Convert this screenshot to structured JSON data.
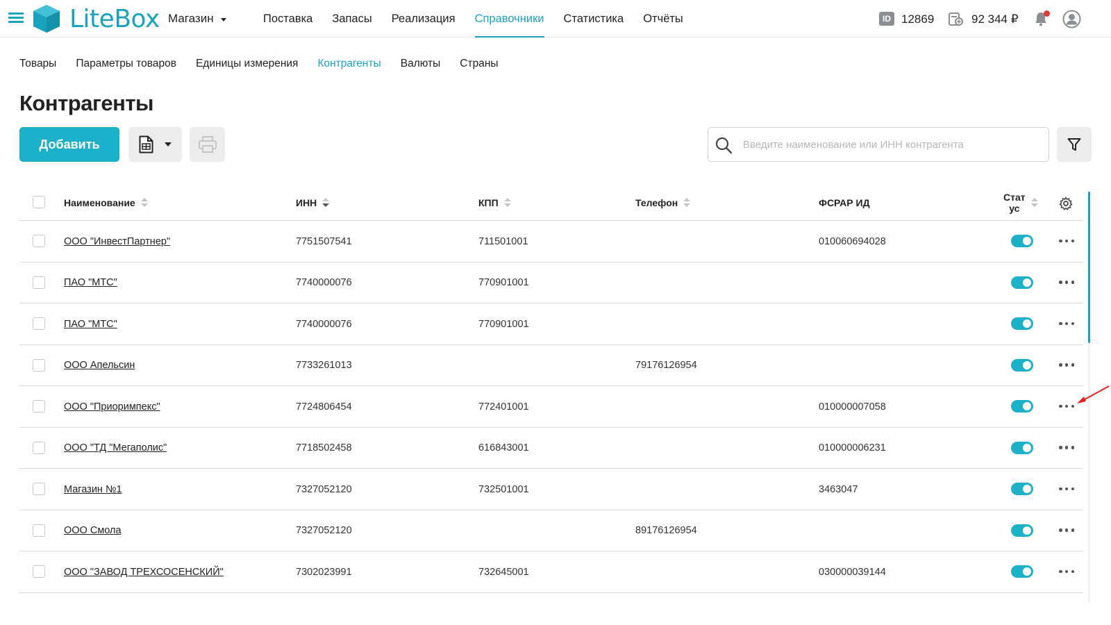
{
  "header": {
    "logo_text": "LiteBox",
    "store": "Магазин",
    "nav": [
      {
        "label": "Поставка"
      },
      {
        "label": "Запасы"
      },
      {
        "label": "Реализация"
      },
      {
        "label": "Справочники"
      },
      {
        "label": "Статистика"
      },
      {
        "label": "Отчёты"
      }
    ],
    "active_nav": "Справочники",
    "id_badge": "ID",
    "account_id": "12869",
    "balance": "92 344 ₽"
  },
  "subnav": {
    "items": [
      {
        "label": "Товары"
      },
      {
        "label": "Параметры товаров"
      },
      {
        "label": "Единицы измерения"
      },
      {
        "label": "Контрагенты"
      },
      {
        "label": "Валюты"
      },
      {
        "label": "Страны"
      }
    ],
    "active": "Контрагенты"
  },
  "page": {
    "title": "Контрагенты",
    "add_label": "Добавить",
    "search_placeholder": "Введите наименование или ИНН контрагента"
  },
  "table": {
    "columns": {
      "name": "Наименование",
      "inn": "ИНН",
      "kpp": "КПП",
      "phone": "Телефон",
      "fsrar": "ФСРАР ИД",
      "status_line1": "Стат",
      "status_line2": "ус"
    },
    "rows": [
      {
        "name": "ООО \"ИнвестПартнер\"",
        "inn": "7751507541",
        "kpp": "711501001",
        "phone": "",
        "fsrar": "010060694028",
        "status": true
      },
      {
        "name": "ПАО \"МТС\"",
        "inn": "7740000076",
        "kpp": "770901001",
        "phone": "",
        "fsrar": "",
        "status": true
      },
      {
        "name": "ПАО \"МТС\"",
        "inn": "7740000076",
        "kpp": "770901001",
        "phone": "",
        "fsrar": "",
        "status": true
      },
      {
        "name": "ООО Апельсин",
        "inn": "7733261013",
        "kpp": "",
        "phone": "79176126954",
        "fsrar": "",
        "status": true
      },
      {
        "name": "ООО \"Приоримпекс\"",
        "inn": "7724806454",
        "kpp": "772401001",
        "phone": "",
        "fsrar": "010000007058",
        "status": true
      },
      {
        "name": "ООО \"ТД \"Мегаполис\"",
        "inn": "7718502458",
        "kpp": "616843001",
        "phone": "",
        "fsrar": "010000006231",
        "status": true
      },
      {
        "name": "Магазин №1",
        "inn": "7327052120",
        "kpp": "732501001",
        "phone": "",
        "fsrar": "3463047",
        "status": true
      },
      {
        "name": "ООО Смола",
        "inn": "7327052120",
        "kpp": "",
        "phone": "89176126954",
        "fsrar": "",
        "status": true
      },
      {
        "name": "ООО \"ЗАВОД ТРЕХСОСЕНСКИЙ\"",
        "inn": "7302023991",
        "kpp": "732645001",
        "phone": "",
        "fsrar": "030000039144",
        "status": true
      }
    ]
  },
  "colors": {
    "accent": "#1aa3bf",
    "button": "#1ab1c9",
    "annotation": "#e32222"
  }
}
